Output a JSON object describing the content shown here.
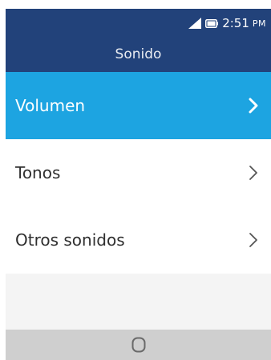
{
  "status_bar": {
    "time": "2:51",
    "ampm": "PM",
    "icons": [
      "signal-icon",
      "battery-icon"
    ]
  },
  "header": {
    "title": "Sonido"
  },
  "menu": {
    "items": [
      {
        "label": "Volumen",
        "selected": true
      },
      {
        "label": "Tonos",
        "selected": false
      },
      {
        "label": "Otros sonidos",
        "selected": false
      }
    ]
  },
  "softkeys": {
    "center_icon": "home-icon"
  },
  "colors": {
    "header_bg": "#22427a",
    "selected_bg": "#1da4e1",
    "softkey_bg": "#cfcfcf",
    "text": "#2f2f2f"
  }
}
